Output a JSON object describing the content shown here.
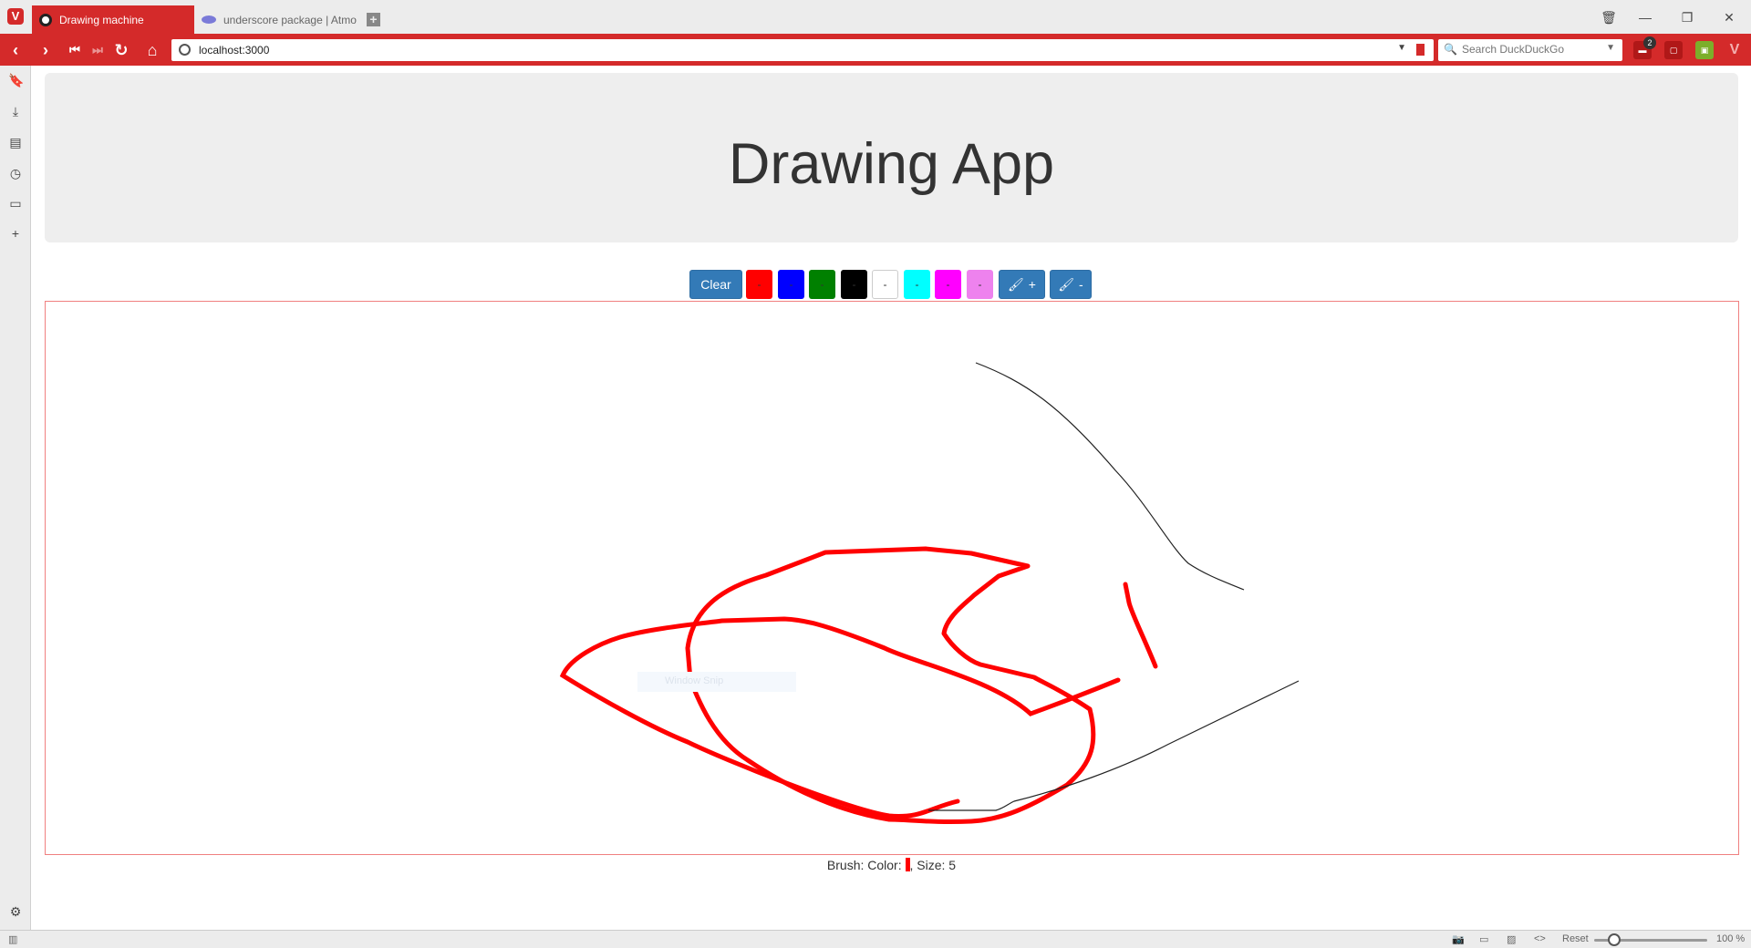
{
  "browser": {
    "tabs": [
      {
        "label": "Drawing machine",
        "active": true
      },
      {
        "label": "underscore package | Atmosphere",
        "active": false
      }
    ],
    "address": "localhost:3000",
    "search_placeholder": "Search DuckDuckGo",
    "notification_count": "2",
    "accent_color": "#d42a2a"
  },
  "statusbar": {
    "reset_label": "Reset",
    "zoom_label": "100 %"
  },
  "app": {
    "title": "Drawing App",
    "clear_label": "Clear",
    "swatches": [
      {
        "color": "#ff0000",
        "label": "-"
      },
      {
        "color": "#0000ff",
        "label": "-"
      },
      {
        "color": "#008000",
        "label": "-"
      },
      {
        "color": "#000000",
        "label": "-"
      },
      {
        "color": "#ffffff",
        "label": "-"
      },
      {
        "color": "#00ffff",
        "label": "-"
      },
      {
        "color": "#ff00ff",
        "label": "-"
      },
      {
        "color": "#ee82ee",
        "label": "-"
      }
    ],
    "brush_plus_label": "+",
    "brush_minus_label": "-",
    "brush_info_prefix": "Brush: Color: ",
    "brush_info_suffix": ", Size: 5",
    "brush_color": "#ff0000",
    "snip_label": "Window Snip"
  }
}
